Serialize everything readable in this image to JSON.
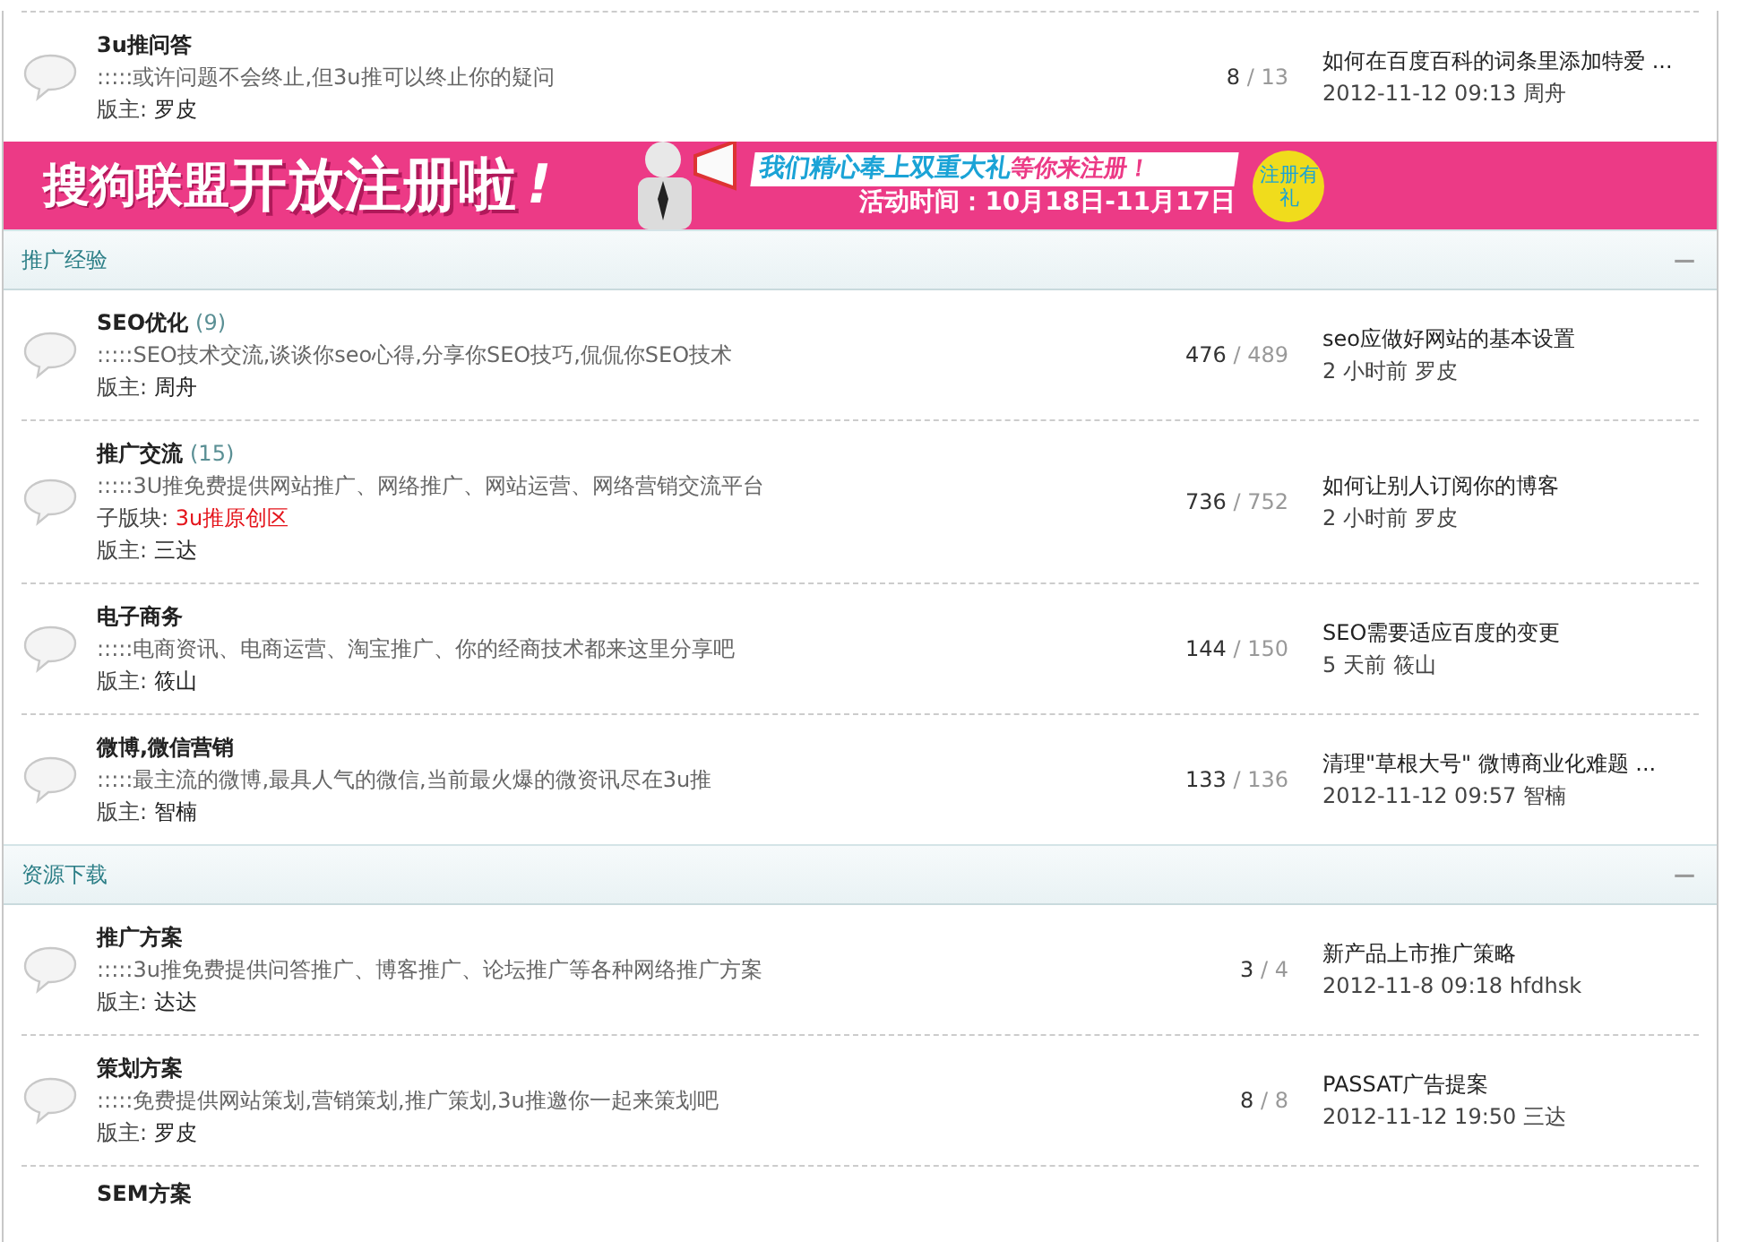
{
  "top_forum": {
    "title": "3u推问答",
    "description": ":::::或许问题不会终止,但3u推可以终止你的疑问",
    "moderator_label": "版主:",
    "moderator": "罗皮",
    "threads": "8",
    "separator": "/",
    "posts": "13",
    "last_post": "如何在百度百科的词条里添加特爱 ...",
    "last_meta": "2012-11-12 09:13 周舟"
  },
  "banner": {
    "headline": "搜狗联盟",
    "headline_big": "开放注册啦",
    "exclaim": "!",
    "offer": "我们精心奉上双重大礼",
    "offer_tail": "等你来注册！",
    "period": "活动时间：10月18日-11月17日",
    "badge": "注册有礼"
  },
  "sections": [
    {
      "title": "推广经验",
      "collapse": "—",
      "forums": [
        {
          "title": "SEO优化",
          "count": "(9)",
          "description": ":::::SEO技术交流,谈谈你seo心得,分享你SEO技巧,侃侃你SEO技术",
          "moderator_label": "版主:",
          "moderator": "周舟",
          "threads": "476",
          "separator": "/",
          "posts": "489",
          "last_post": "seo应做好网站的基本设置",
          "last_meta": "2 小时前 罗皮"
        },
        {
          "title": "推广交流",
          "count": "(15)",
          "description": ":::::3U推免费提供网站推广、网络推广、网站运营、网络营销交流平台",
          "subforum_label": "子版块:",
          "subforum": "3u推原创区",
          "moderator_label": "版主:",
          "moderator": "三达",
          "threads": "736",
          "separator": "/",
          "posts": "752",
          "last_post": "如何让别人订阅你的博客",
          "last_meta": "2 小时前 罗皮"
        },
        {
          "title": "电子商务",
          "description": ":::::电商资讯、电商运营、淘宝推广、你的经商技术都来这里分享吧",
          "moderator_label": "版主:",
          "moderator": "筱山",
          "threads": "144",
          "separator": "/",
          "posts": "150",
          "last_post": "SEO需要适应百度的变更",
          "last_meta": "5 天前 筱山"
        },
        {
          "title": "微博,微信营销",
          "description": ":::::最主流的微博,最具人气的微信,当前最火爆的微资讯尽在3u推",
          "moderator_label": "版主:",
          "moderator": "智楠",
          "threads": "133",
          "separator": "/",
          "posts": "136",
          "last_post": "清理\"草根大号\" 微博商业化难题 ...",
          "last_meta": "2012-11-12 09:57 智楠"
        }
      ]
    },
    {
      "title": "资源下载",
      "collapse": "—",
      "forums": [
        {
          "title": "推广方案",
          "description": ":::::3u推免费提供问答推广、博客推广、论坛推广等各种网络推广方案",
          "moderator_label": "版主:",
          "moderator": "达达",
          "threads": "3",
          "separator": "/",
          "posts": "4",
          "last_post": "新产品上市推广策略",
          "last_meta": "2012-11-8 09:18 hfdhsk"
        },
        {
          "title": "策划方案",
          "description": ":::::免费提供网站策划,营销策划,推广策划,3u推邀你一起来策划吧",
          "moderator_label": "版主:",
          "moderator": "罗皮",
          "threads": "8",
          "separator": "/",
          "posts": "8",
          "last_post": "PASSAT广告提案",
          "last_meta": "2012-11-12 19:50 三达"
        },
        {
          "title": "SEM方案"
        }
      ]
    }
  ]
}
